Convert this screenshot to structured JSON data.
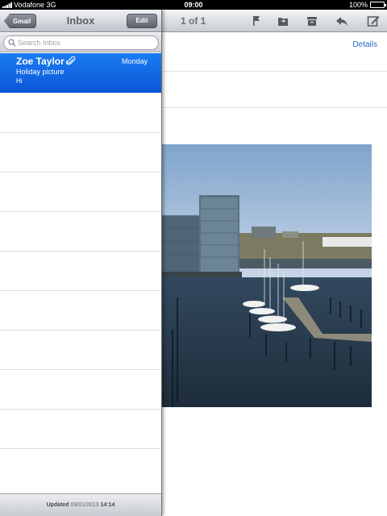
{
  "status_bar": {
    "carrier": "Vodafone 3G",
    "time": "09:00",
    "battery": "100%",
    "battery_level": 1.0
  },
  "inbox": {
    "back_label": "Gmail",
    "title": "Inbox",
    "edit_label": "Edit",
    "search_placeholder": "Search Inbox",
    "messages": [
      {
        "from": "Zoe Taylor",
        "date": "Monday",
        "subject": "Holiday picture",
        "preview": "Hi",
        "has_attachment": true,
        "selected": true
      }
    ],
    "footer": {
      "label": "Updated",
      "date": "09/01/2013",
      "time": "14:14"
    }
  },
  "detail": {
    "counter": "1 of 1",
    "details_link": "Details",
    "toolbar_icons": [
      "flag-icon",
      "move-folder-icon",
      "archive-icon",
      "reply-icon",
      "compose-icon"
    ]
  },
  "colors": {
    "selection": "#0a64e6",
    "link": "#2867c7",
    "toolbar_text": "#6b717a"
  }
}
